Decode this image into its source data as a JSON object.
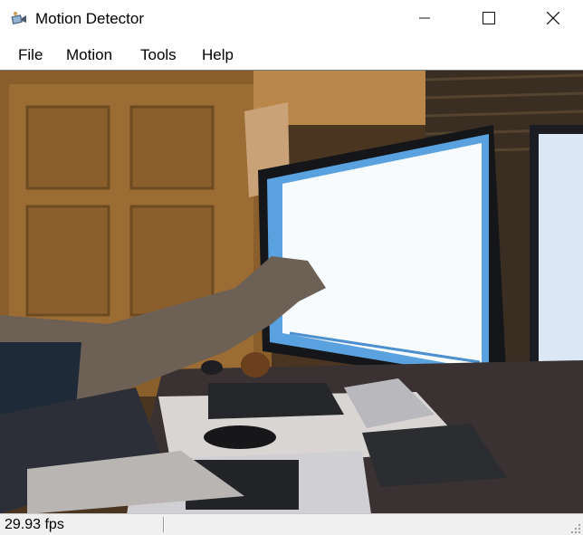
{
  "window": {
    "title": "Motion Detector",
    "icon": "camera-icon"
  },
  "caption_buttons": {
    "minimize_icon": "minimize-icon",
    "maximize_icon": "maximize-icon",
    "close_icon": "close-icon"
  },
  "menu": {
    "items": [
      {
        "label": "File"
      },
      {
        "label": "Motion"
      },
      {
        "label": "Tools"
      },
      {
        "label": "Help"
      }
    ]
  },
  "video": {
    "content": "live-camera-feed"
  },
  "status": {
    "fps": "29.93 fps"
  }
}
